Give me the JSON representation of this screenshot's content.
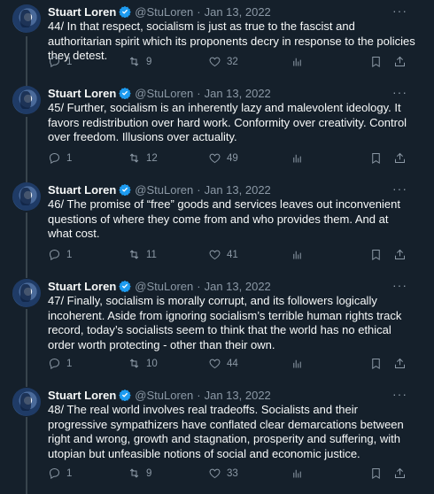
{
  "author": {
    "name": "Stuart Loren",
    "handle": "@StuLoren",
    "date": "Jan 13, 2022",
    "verified_color": "#1d9bf0"
  },
  "more_label": "···",
  "tweets": [
    {
      "text": "44/ In that respect, socialism is just as true to the fascist and authoritarian spirit which its proponents decry in response to the policies they detest.",
      "replies": "1",
      "retweets": "9",
      "likes": "32"
    },
    {
      "text": "45/ Further, socialism is an inherently lazy and malevolent ideology. It favors redistribution over hard work. Conformity over creativity. Control over freedom. Illusions over actuality.",
      "replies": "1",
      "retweets": "12",
      "likes": "49"
    },
    {
      "text": "46/ The promise of “free” goods and services leaves out inconvenient questions of where they come from and who provides them. And at what cost.",
      "replies": "1",
      "retweets": "11",
      "likes": "41"
    },
    {
      "text": "47/ Finally, socialism is morally corrupt, and its followers logically incoherent. Aside from ignoring socialism’s terrible human rights track record, today’s socialists seem to think that the world has no ethical order worth protecting - other than their own.",
      "replies": "1",
      "retweets": "10",
      "likes": "44"
    },
    {
      "text": "48/ The real world involves real tradeoffs. Socialists and their progressive sympathizers have conflated clear demarcations between right and wrong, growth and stagnation, prosperity and suffering, with utopian but unfeasible notions of social and economic justice.",
      "replies": "1",
      "retweets": "9",
      "likes": "33"
    }
  ]
}
